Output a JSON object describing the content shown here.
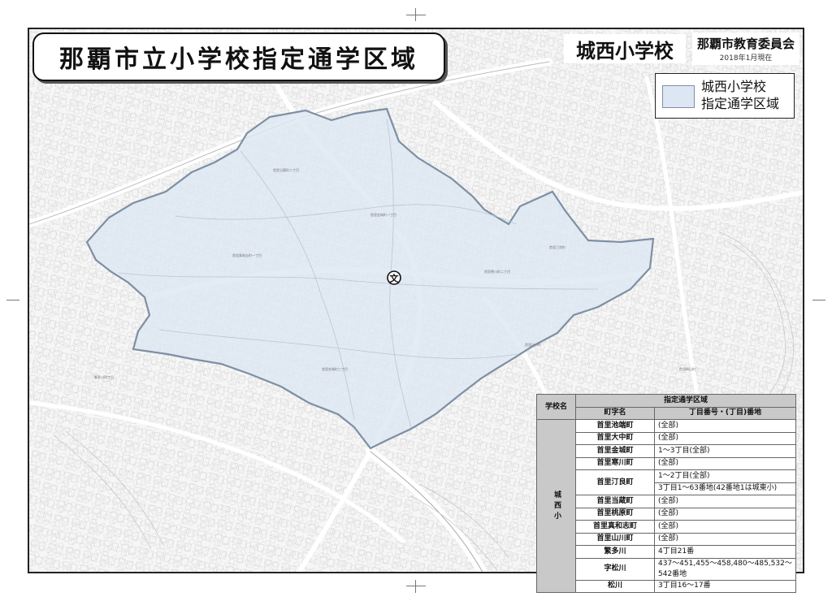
{
  "title": "那覇市立小学校指定通学区域",
  "school_name": "城西小学校",
  "publisher": "那覇市教育委員会",
  "date": "2018年1月現在",
  "legend": {
    "line1": "城西小学校",
    "line2": "指定通学区域",
    "fill_color": "#dde7f3",
    "border_color": "#7e8fa3"
  },
  "map": {
    "school_symbol": "文",
    "school_symbol_icon": "school-map-symbol-icon"
  },
  "table": {
    "header_school": "学校名",
    "header_zone": "指定通学区域",
    "header_town": "町字名",
    "header_blocks": "丁目番号・(丁目)番地",
    "school": "城西小",
    "rows": [
      {
        "town": "首里池端町",
        "detail": "(全部)"
      },
      {
        "town": "首里大中町",
        "detail": "(全部)"
      },
      {
        "town": "首里金城町",
        "detail": "1～3丁目(全部)"
      },
      {
        "town": "首里寒川町",
        "detail": "(全部)"
      },
      {
        "town": "首里汀良町",
        "detail": "1～2丁目(全部)"
      },
      {
        "town": "",
        "detail": "3丁目1～63番地(42番地1は城東小)"
      },
      {
        "town": "首里当蔵町",
        "detail": "(全部)"
      },
      {
        "town": "首里桃原町",
        "detail": "(全部)"
      },
      {
        "town": "首里真和志町",
        "detail": "(全部)"
      },
      {
        "town": "首里山川町",
        "detail": "(全部)"
      },
      {
        "town": "繁多川",
        "detail": "4丁目21番"
      },
      {
        "town": "字松川",
        "detail": "437～451,455～458,480～485,532～542番地"
      },
      {
        "town": "松川",
        "detail": "3丁目16～17番"
      }
    ]
  }
}
